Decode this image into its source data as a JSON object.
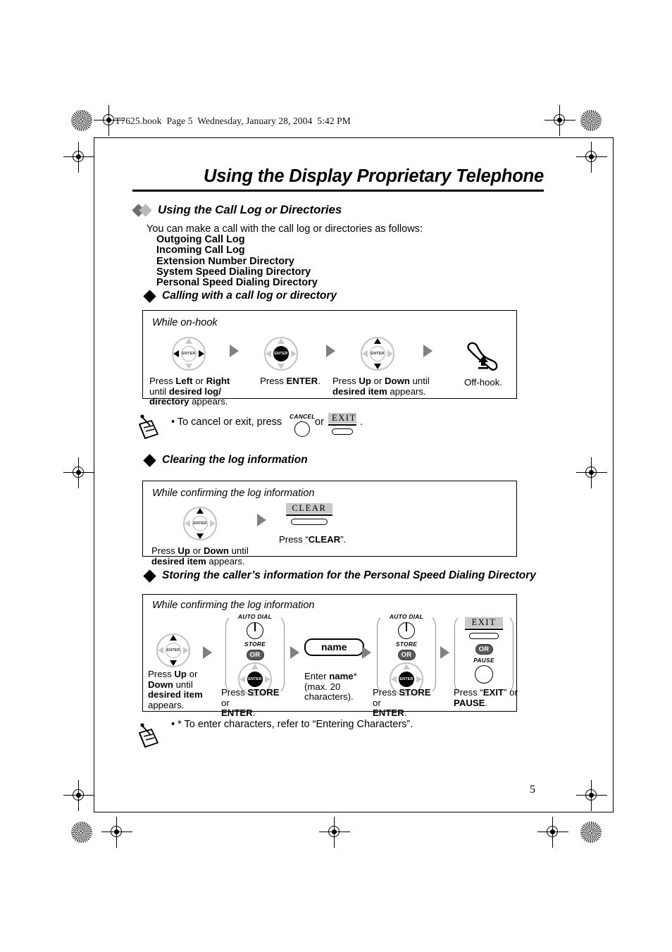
{
  "book_header": "T7625.book  Page 5  Wednesday, January 28, 2004  5:42 PM",
  "page_title": "Using the Display Proprietary Telephone",
  "page_number": "5",
  "section": {
    "heading": "Using the Call Log or Directories",
    "intro": "You can make a call with the call log or directories as follows:",
    "items": [
      "Outgoing Call Log",
      "Incoming Call Log",
      "Extension Number Directory",
      "System Speed Dialing Directory",
      "Personal Speed Dialing Directory"
    ]
  },
  "sub1": {
    "heading": "Calling with a call log or directory",
    "condition": "While on-hook",
    "steps": [
      {
        "key_label": "ENTER",
        "caption_html": "Press <b>Left</b> or <b>Right</b><br>until <b>desired log/</b><br><b>directory</b> appears."
      },
      {
        "key_label": "ENTER",
        "caption_html": "Press <b>ENTER</b>."
      },
      {
        "key_label": "ENTER",
        "caption_html": "Press <b>Up</b> or <b>Down</b> until<br><b>desired item</b> appears."
      },
      {
        "key_label": "",
        "caption_html": "Off-hook."
      }
    ]
  },
  "note1": {
    "text_before": "• To cancel or exit, press",
    "cancel_label": "CANCEL",
    "or_text": "or",
    "exit_label": "EXIT",
    "text_after": "."
  },
  "sub2": {
    "heading": "Clearing the log information",
    "condition": "While confirming the log information",
    "steps": [
      {
        "key_label": "ENTER",
        "caption_html": "Press <b>Up</b> or <b>Down</b> until<br><b>desired item</b> appears."
      },
      {
        "key_label": "CLEAR",
        "caption_html": "Press “<b>CLEAR</b>”."
      }
    ]
  },
  "sub3": {
    "heading": "Storing the caller’s information for the Personal Speed Dialing Directory",
    "condition": "While confirming the log information",
    "steps": [
      {
        "key_label": "ENTER",
        "caption_html": "Press <b>Up</b> or<br><b>Down</b> until<br><b>desired item</b><br>appears."
      },
      {
        "top_label": "AUTO DIAL",
        "bottom_label": "STORE",
        "or_label": "OR",
        "key_label": "ENTER",
        "caption_html": "Press <b>STORE</b> or<br><b>ENTER</b>."
      },
      {
        "field_value": "name",
        "caption_html": "Enter <b>name</b>*<br>(max. 20<br>characters)."
      },
      {
        "top_label": "AUTO DIAL",
        "bottom_label": "STORE",
        "or_label": "OR",
        "key_label": "ENTER",
        "caption_html": "Press <b>STORE</b> or<br><b>ENTER</b>."
      },
      {
        "exit_label": "EXIT",
        "or_label": "OR",
        "pause_label": "PAUSE",
        "caption_html": "Press “<b>EXIT</b>” or<br><b>PAUSE</b>."
      }
    ]
  },
  "note2": {
    "text": "• * To enter characters, refer to “Entering Characters”."
  },
  "colors": {
    "diamond_dark": "#6e6e6e",
    "diamond_light": "#b8b8b8",
    "arrow_gray": "#808080",
    "key_ring_gray": "#c3c3c3",
    "or_badge": "#5a5a5a",
    "label_highlight": "#c9c9c9"
  }
}
